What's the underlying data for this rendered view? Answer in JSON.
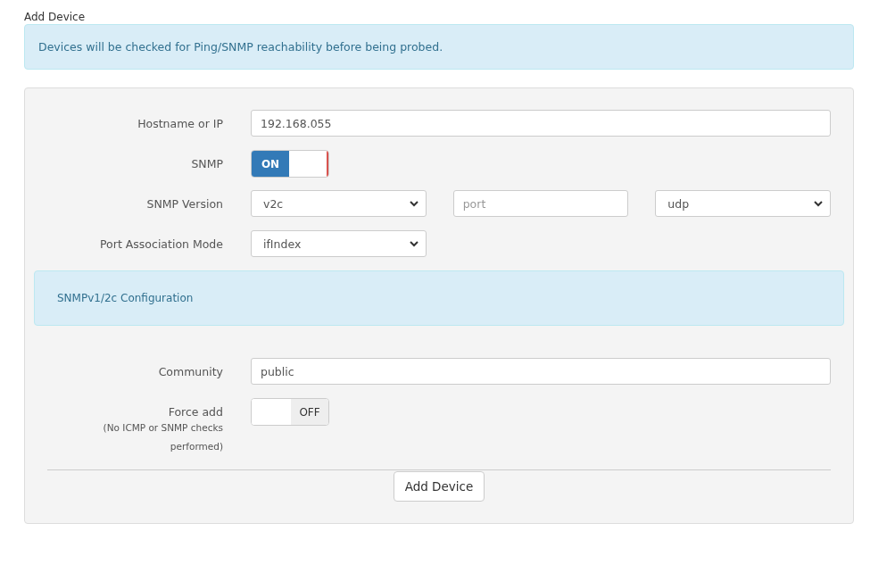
{
  "page_title": "Add Device",
  "notice": "Devices will be checked for Ping/SNMP reachability before being probed.",
  "form": {
    "hostname": {
      "label": "Hostname or IP",
      "value": "192.168.055"
    },
    "snmp": {
      "label": "SNMP",
      "on": true,
      "text": "ON"
    },
    "snmp_version": {
      "label": "SNMP Version",
      "version": "v2c",
      "port_placeholder": "port",
      "transport": "udp"
    },
    "port_association": {
      "label": "Port Association Mode",
      "value": "ifIndex"
    },
    "section_title": "SNMPv1/2c Configuration",
    "community": {
      "label": "Community",
      "value": "public"
    },
    "force_add": {
      "label": "Force add",
      "note": "(No ICMP or SNMP checks performed)",
      "on": false,
      "text": "OFF"
    },
    "submit": "Add Device"
  }
}
